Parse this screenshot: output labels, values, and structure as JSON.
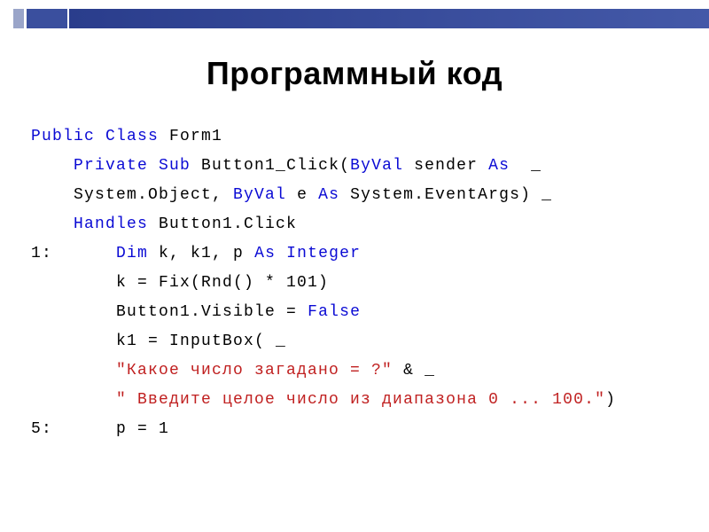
{
  "title": "Программный код",
  "code": {
    "line1": {
      "kw1": "Public Class",
      "t1": " Form1"
    },
    "line2": {
      "indent": "    ",
      "kw1": "Private Sub",
      "t1": " Button1_Click(",
      "kw2": "ByVal",
      "t2": " sender ",
      "kw3": "As",
      "t3": "  _"
    },
    "line3": {
      "indent": "    ",
      "t1": "System.Object, ",
      "kw1": "ByVal",
      "t2": " e ",
      "kw2": "As",
      "t3": " System.EventArgs) _"
    },
    "line4": {
      "indent": "    ",
      "kw1": "Handles",
      "t1": " Button1.Click"
    },
    "line5": {
      "lbl": "1:      ",
      "kw1": "Dim",
      "t1": " k, k1, p ",
      "kw2": "As Integer"
    },
    "line6": {
      "indent": "        ",
      "t1": "k = Fix(Rnd() * 101)"
    },
    "line7": {
      "indent": "        ",
      "t1": "Button1.Visible = ",
      "kw1": "False"
    },
    "line8": {
      "indent": "        ",
      "t1": "k1 = InputBox( _"
    },
    "line9": {
      "indent": "        ",
      "str1": "\"Какое число загадано = ?\"",
      "t1": " & _"
    },
    "line10": {
      "indent": "        ",
      "str1": "\" Введите целое число из диапазона 0 ... 100.\"",
      "t1": ")"
    },
    "line11": {
      "lbl": "5:      ",
      "t1": "p = 1"
    }
  }
}
